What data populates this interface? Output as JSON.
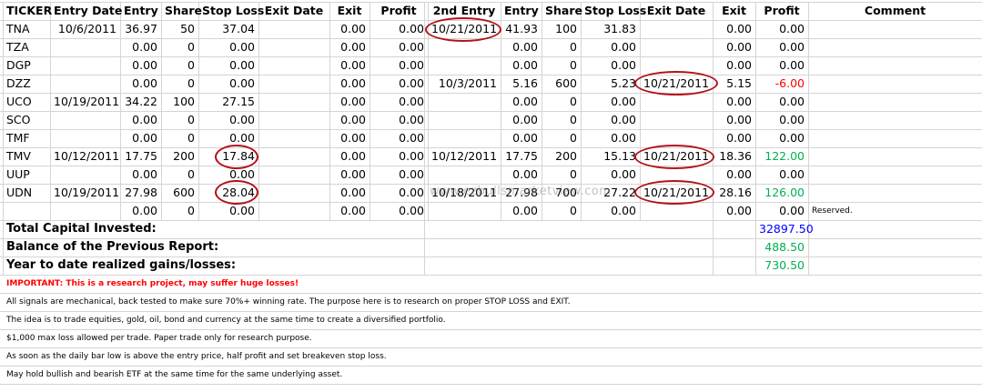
{
  "headers": [
    "TICKER",
    "Entry Date",
    "Entry",
    "Share",
    "Stop Loss",
    "Exit Date",
    "Exit",
    "Profit",
    "2nd Entry",
    "Entry",
    "Share",
    "Stop Loss",
    "Exit Date",
    "Exit",
    "Profit",
    "Comment"
  ],
  "rows": [
    [
      "TNA",
      "10/6/2011",
      "36.97",
      "50",
      "37.04",
      "",
      "0.00",
      "0.00",
      "10/21/2011",
      "41.93",
      "100",
      "31.83",
      "",
      "0.00",
      "0.00",
      ""
    ],
    [
      "TZA",
      "",
      "0.00",
      "0",
      "0.00",
      "",
      "0.00",
      "0.00",
      "",
      "0.00",
      "0",
      "0.00",
      "",
      "0.00",
      "0.00",
      ""
    ],
    [
      "DGP",
      "",
      "0.00",
      "0",
      "0.00",
      "",
      "0.00",
      "0.00",
      "",
      "0.00",
      "0",
      "0.00",
      "",
      "0.00",
      "0.00",
      ""
    ],
    [
      "DZZ",
      "",
      "0.00",
      "0",
      "0.00",
      "",
      "0.00",
      "0.00",
      "10/3/2011",
      "5.16",
      "600",
      "5.23",
      "10/21/2011",
      "5.15",
      "-6.00",
      ""
    ],
    [
      "UCO",
      "10/19/2011",
      "34.22",
      "100",
      "27.15",
      "",
      "0.00",
      "0.00",
      "",
      "0.00",
      "0",
      "0.00",
      "",
      "0.00",
      "0.00",
      ""
    ],
    [
      "SCO",
      "",
      "0.00",
      "0",
      "0.00",
      "",
      "0.00",
      "0.00",
      "",
      "0.00",
      "0",
      "0.00",
      "",
      "0.00",
      "0.00",
      ""
    ],
    [
      "TMF",
      "",
      "0.00",
      "0",
      "0.00",
      "",
      "0.00",
      "0.00",
      "",
      "0.00",
      "0",
      "0.00",
      "",
      "0.00",
      "0.00",
      ""
    ],
    [
      "TMV",
      "10/12/2011",
      "17.75",
      "200",
      "17.84",
      "",
      "0.00",
      "0.00",
      "10/12/2011",
      "17.75",
      "200",
      "15.13",
      "10/21/2011",
      "18.36",
      "122.00",
      ""
    ],
    [
      "UUP",
      "",
      "0.00",
      "0",
      "0.00",
      "",
      "0.00",
      "0.00",
      "",
      "0.00",
      "0",
      "0.00",
      "",
      "0.00",
      "0.00",
      ""
    ],
    [
      "UDN",
      "10/19/2011",
      "27.98",
      "600",
      "28.04",
      "",
      "0.00",
      "0.00",
      "10/18/2011",
      "27.98",
      "700",
      "27.22",
      "10/21/2011",
      "28.16",
      "126.00",
      ""
    ],
    [
      "",
      "",
      "0.00",
      "0",
      "0.00",
      "",
      "0.00",
      "0.00",
      "",
      "0.00",
      "0",
      "0.00",
      "",
      "0.00",
      "0.00",
      "Reserved."
    ]
  ],
  "summary": [
    {
      "label": "Total Capital Invested:",
      "value": "32897.50",
      "color": "#0000ff"
    },
    {
      "label": "Balance of the Previous Report:",
      "value": "488.50",
      "color": "#00b050"
    },
    {
      "label": "Year to date realized gains/losses:",
      "value": "730.50",
      "color": "#00b050"
    }
  ],
  "notes": [
    "IMPORTANT: This is a research project, may suffer huge losses!",
    "All signals are mechanical, back tested to make sure 70%+ winning rate. The purpose here is to research on proper STOP LOSS and EXIT.",
    "The idea is to trade equities, gold, oil, bond and currency at the same time to create a diversified portfolio.",
    "$1,000 max loss allowed per trade. Paper trade only for research purpose.",
    "As soon as the daily bar low is above the entry price, half profit and set breakeven stop loss.",
    "May hold bullish and bearish ETF at the same time for the same underlying asset."
  ],
  "watermark": "www.ezbullsmarketview.com",
  "colors": {
    "negative": "#ff0000",
    "positive": "#00b050",
    "capital": "#0000ff",
    "highlight_oval": "#b3121a",
    "gridline": "#d4d4d4"
  }
}
